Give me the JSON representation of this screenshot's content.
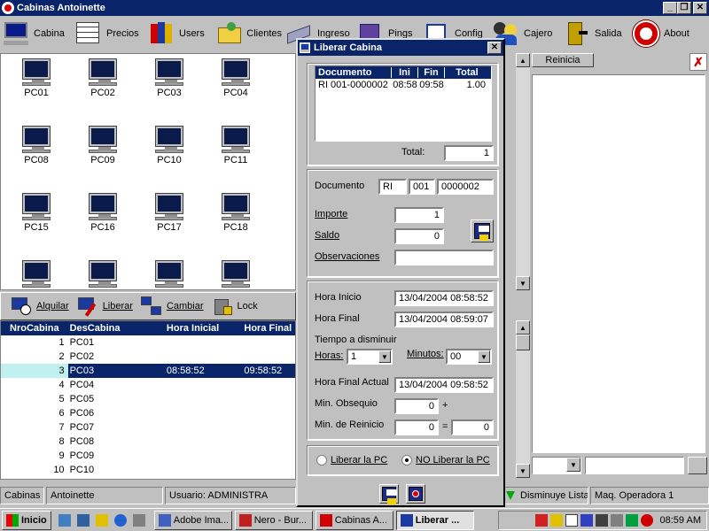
{
  "window": {
    "title": "Cabinas Antoinette"
  },
  "toolbar": [
    {
      "label": "Cabina",
      "icon": "computer-icon"
    },
    {
      "label": "Precios",
      "icon": "calendar-grid-icon"
    },
    {
      "label": "Users",
      "icon": "users-group-icon"
    },
    {
      "label": "Clientes",
      "icon": "folder-clients-icon"
    },
    {
      "label": "Ingreso",
      "icon": "keyboard-icon"
    },
    {
      "label": "Pings",
      "icon": "network-icon"
    },
    {
      "label": "Config",
      "icon": "settings-icon"
    },
    {
      "label": "Cajero",
      "icon": "cashier-people-icon"
    },
    {
      "label": "Salida",
      "icon": "exit-door-icon"
    },
    {
      "label": "About",
      "icon": "about-logo-icon"
    }
  ],
  "pcs": [
    "PC01",
    "PC02",
    "PC03",
    "PC04",
    "PC08",
    "PC09",
    "PC10",
    "PC11",
    "PC15",
    "PC16",
    "PC17",
    "PC18"
  ],
  "actions": {
    "alquilar": "Alquilar",
    "liberar": "Liberar",
    "cambiar": "Cambiar",
    "lock": "Lock"
  },
  "grid": {
    "headers": [
      "NroCabina",
      "DesCabina",
      "Hora Inicial",
      "Hora Final"
    ],
    "rows": [
      {
        "nro": "1",
        "des": "PC01",
        "ini": "",
        "fin": ""
      },
      {
        "nro": "2",
        "des": "PC02",
        "ini": "",
        "fin": ""
      },
      {
        "nro": "3",
        "des": "PC03",
        "ini": "08:58:52",
        "fin": "09:58:52"
      },
      {
        "nro": "4",
        "des": "PC04",
        "ini": "",
        "fin": ""
      },
      {
        "nro": "5",
        "des": "PC05",
        "ini": "",
        "fin": ""
      },
      {
        "nro": "6",
        "des": "PC06",
        "ini": "",
        "fin": ""
      },
      {
        "nro": "7",
        "des": "PC07",
        "ini": "",
        "fin": ""
      },
      {
        "nro": "8",
        "des": "PC08",
        "ini": "",
        "fin": ""
      },
      {
        "nro": "9",
        "des": "PC09",
        "ini": "",
        "fin": ""
      },
      {
        "nro": "10",
        "des": "PC10",
        "ini": "",
        "fin": ""
      }
    ],
    "selected_index": 2
  },
  "status": {
    "s1": "Cabinas",
    "s2": "Antoinette",
    "s3": "Usuario: ADMINISTRA",
    "s4": "Disminuye Lista",
    "s5": "Maq. Operadora 1"
  },
  "right": {
    "reinicia": "Reinicia"
  },
  "dialog": {
    "title": "Liberar Cabina",
    "table": {
      "headers": [
        "Documento",
        "Ini",
        "Fin",
        "Total"
      ],
      "row": {
        "doc": "RI 001-0000002",
        "ini": "08:58",
        "fin": "09:58",
        "total": "1.00"
      }
    },
    "total_label": "Total:",
    "total_value": "1",
    "documento_label": "Documento",
    "doc_a": "RI",
    "doc_b": "001",
    "doc_c": "0000002",
    "importe_label": "Importe",
    "importe": "1",
    "saldo_label": "Saldo",
    "saldo": "0",
    "obs_label": "Observaciones",
    "obs": "",
    "hora_inicio_label": "Hora Inicio",
    "hora_inicio": "13/04/2004 08:58:52",
    "hora_final_label": "Hora Final",
    "hora_final": "13/04/2004 08:59:07",
    "tiempo_label": "Tiempo a disminuir",
    "horas_label": "Horas:",
    "horas": "1",
    "minutos_label": "Minutos:",
    "minutos": "00",
    "hora_final_actual_label": "Hora Final Actual",
    "hora_final_actual": "13/04/2004 09:58:52",
    "min_obsequio_label": "Min. Obsequio",
    "min_obsequio": "0",
    "plus": "+",
    "min_reinicio_label": "Min. de Reinicio",
    "min_reinicio": "0",
    "equals": "=",
    "min_result": "0",
    "radio_liberar": "Liberar la PC",
    "radio_no_liberar": "NO Liberar la PC"
  },
  "taskbar": {
    "start": "Inicio",
    "tasks": [
      {
        "label": "Adobe Ima...",
        "active": false
      },
      {
        "label": "Nero - Bur...",
        "active": false
      },
      {
        "label": "Cabinas A...",
        "active": false
      },
      {
        "label": "Liberar ...",
        "active": true
      }
    ],
    "clock": "08:59 AM"
  },
  "colors": {
    "titlebar": "#0a246a",
    "selection": "#0a246a",
    "face": "#c0c0c0"
  }
}
